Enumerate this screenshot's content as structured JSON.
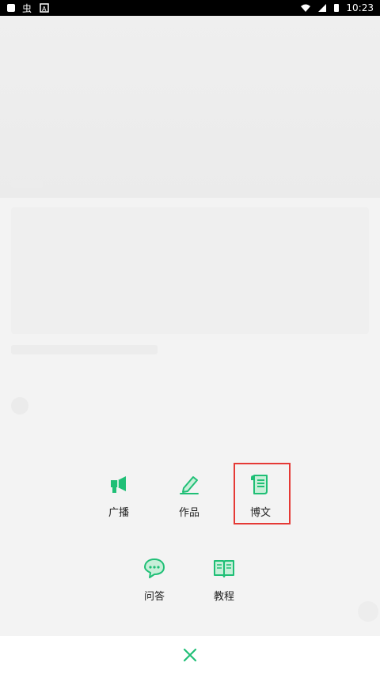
{
  "status_bar": {
    "time": "10:23",
    "left_icons": [
      "square-icon",
      "bug-icon",
      "text-a-icon"
    ],
    "right_icons": [
      "wifi-icon",
      "signal-icon",
      "battery-icon"
    ]
  },
  "menu": {
    "items": [
      {
        "label": "广播",
        "icon": "megaphone-icon"
      },
      {
        "label": "作品",
        "icon": "pen-icon"
      },
      {
        "label": "博文",
        "icon": "scroll-icon"
      },
      {
        "label": "问答",
        "icon": "chat-bubble-icon"
      },
      {
        "label": "教程",
        "icon": "book-icon"
      }
    ],
    "accent_color": "#1fbf76",
    "highlight_color": "#e53935"
  },
  "close": {
    "icon": "close-icon"
  }
}
